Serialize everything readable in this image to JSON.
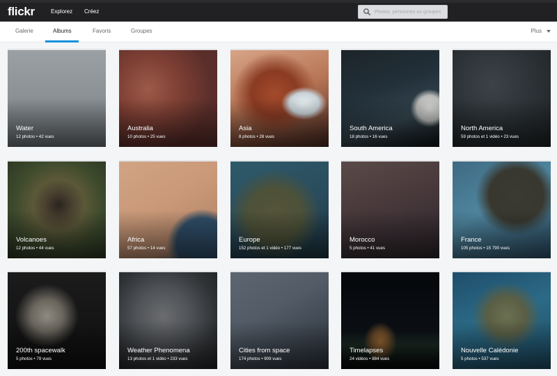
{
  "header": {
    "logo": "flickr",
    "nav": [
      "Explorez",
      "Créez"
    ],
    "search_placeholder": "Photos, personnes ou groupes"
  },
  "subnav": {
    "tabs": [
      "Galerie",
      "Albums",
      "Favoris",
      "Groupes"
    ],
    "active_tab": "Albums",
    "more_label": "Plus"
  },
  "colors": {
    "topbar": "#212124",
    "accent": "#128fdc"
  },
  "albums": [
    {
      "title": "Water",
      "meta": "12 photos  •  42 vues",
      "thumb": "linear-gradient(180deg,#9aa0a4 0%,#8c9296 45%,#6e7478 100%)"
    },
    {
      "title": "Australia",
      "meta": "10 photos  •  25 vues",
      "thumb": "radial-gradient(circle at 30% 40%,#9c5a48 0%,#7e3f34 35%,#5a2e2a 70%),linear-gradient(135deg,#a8664e,#4c2a28)"
    },
    {
      "title": "Asia",
      "meta": "8 photos  •  28 vues",
      "thumb": "radial-gradient(ellipse at 75% 55%,#e8eef0 0%,#c7d2d8 14%,transparent 22%),radial-gradient(ellipse at 45% 45%,#a34a2c 0%,#8a3b22 30%,transparent 55%),linear-gradient(160deg,#d7a487 0%,#b87656 45%,#4b2a22 100%)"
    },
    {
      "title": "South America",
      "meta": "18 photos  •  16 vues",
      "thumb": "radial-gradient(circle at 90% 60%,#d8d8d6 0%,#b9b9b7 12%,transparent 18%),linear-gradient(160deg,#1c2428 0%,#22303a 40%,#34454e 70%,#101417 100%)"
    },
    {
      "title": "North America",
      "meta": "59 photos et 1 vidéo  •  23 vues",
      "thumb": "radial-gradient(circle at 40% 35%,#3c4348 0%,#2b3135 50%,#1d2124 100%)"
    },
    {
      "title": "Volcanoes",
      "meta": "12 photos  •  44 vues",
      "thumb": "radial-gradient(circle at 52% 45%,#2a241e 0%,#4a4030 18%,#5b5838 35%,#3d4a2c 60%,#2a3323 100%)"
    },
    {
      "title": "Africa",
      "meta": "57 photos  •  14 vues",
      "thumb": "radial-gradient(ellipse at 85% 85%,#2f4e68 0%,#2f4e68 22%,transparent 30%),linear-gradient(150deg,#d1a483 0%,#c99878 45%,#b88a6c 75%,#3b5a70 100%)"
    },
    {
      "title": "Europe",
      "meta": "152 photos et 1 vidéo  •  177 vues",
      "thumb": "radial-gradient(ellipse at 45% 55%,#55543a 0%,#4d5238 35%,transparent 60%),linear-gradient(160deg,#2e5a6a 0%,#2a4c5c 50%,#1d3440 100%)"
    },
    {
      "title": "Morocco",
      "meta": "5 photos  •  41 vues",
      "thumb": "linear-gradient(160deg,#5a4a48 0%,#4a3a3c 40%,#3b3035 70%,#2c2529 100%)"
    },
    {
      "title": "France",
      "meta": "105 photos  •  15 790 vues",
      "thumb": "radial-gradient(ellipse at 65% 35%,#3a3a32 0%,#39382f 30%,transparent 45%),linear-gradient(150deg,#3f6a82 0%,#4f86a0 45%,#2e5066 100%)"
    },
    {
      "title": "200th spacewalk",
      "meta": "5 photos  •  79 vues",
      "thumb": "radial-gradient(circle at 40% 45%,#8e8a82 0%,#6a665e 20%,transparent 40%),linear-gradient(180deg,#1b1b1b 0%,#0f0f0f 100%)"
    },
    {
      "title": "Weather Phenomena",
      "meta": "13 photos et 1 vidéo  •  233 vues",
      "thumb": "radial-gradient(circle at 45% 45%,#6a6c6f 0%,#505357 35%,#2f3235 70%,#1f2123 100%)"
    },
    {
      "title": "Cities from space",
      "meta": "174 photos  •  909 vues",
      "thumb": "linear-gradient(150deg,#5d6570 0%,#525b66 40%,#3e4650 70%,#2b3138 100%)"
    },
    {
      "title": "Timelapses",
      "meta": "24 vidéos  •  884 vues",
      "thumb": "radial-gradient(ellipse at 40% 72%,#9b6a34 0%,#6b4a28 10%,transparent 20%),linear-gradient(180deg,#05070a 0%,#0b0f14 60%,#1b2b24 75%,#050607 100%)"
    },
    {
      "title": "Nouvelle Calédonie",
      "meta": "5 photos  •  537 vues",
      "thumb": "radial-gradient(ellipse at 55% 45%,#6c7052 0%,#5a5e44 25%,transparent 45%),linear-gradient(160deg,#1f4e6b 0%,#2b6a86 45%,#1e4c64 100%)"
    }
  ]
}
